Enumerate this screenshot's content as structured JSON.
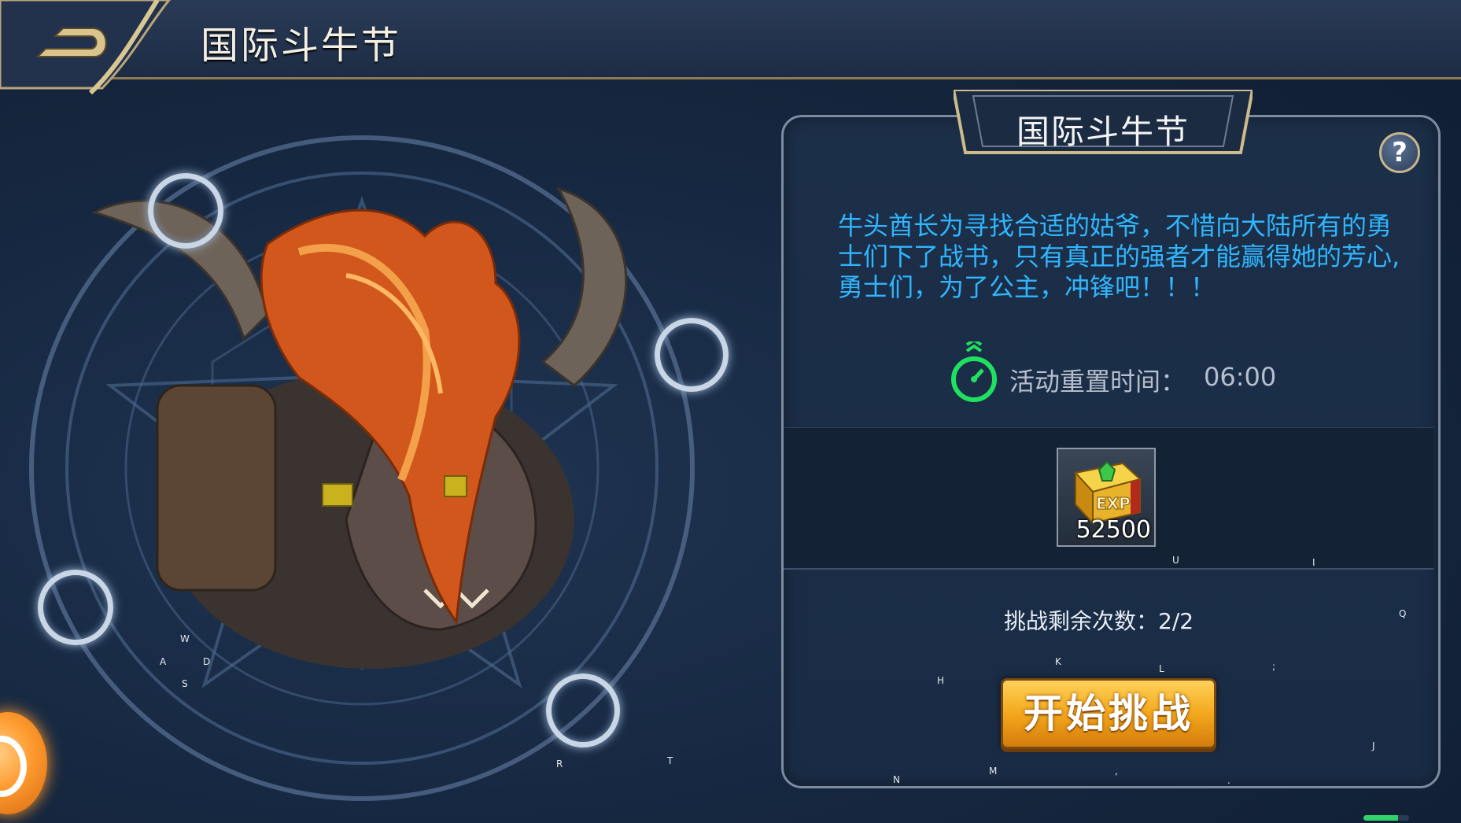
{
  "header": {
    "title": "国际斗牛节"
  },
  "panel": {
    "banner_title": "国际斗牛节",
    "help_label": "?",
    "description": "牛头酋长为寻找合适的姑爷，不惜向大陆所有的勇士们下了战书，只有真正的强者才能赢得她的芳心,勇士们，为了公主，冲锋吧！！！",
    "timer": {
      "label": "活动重置时间：",
      "value": "06:00"
    },
    "reward": {
      "icon": "exp-book-icon",
      "count": "52500"
    },
    "attempts": "挑战剩余次数：2/2",
    "start_button": "开始挑战"
  },
  "joystick_keys": {
    "up": "W",
    "left": "A",
    "right": "D",
    "down": "S"
  },
  "key_overlays": [
    "U",
    "I",
    "Q",
    "K",
    "L",
    ";",
    "H",
    "J",
    "N",
    "M",
    ",",
    ".",
    "R",
    "T"
  ],
  "progress": {
    "fraction": 0.75
  },
  "colors": {
    "accent_gold": "#c9b78a",
    "description_blue": "#2fb6ff",
    "timer_green": "#20e060",
    "button_orange": "#f3a81c"
  }
}
